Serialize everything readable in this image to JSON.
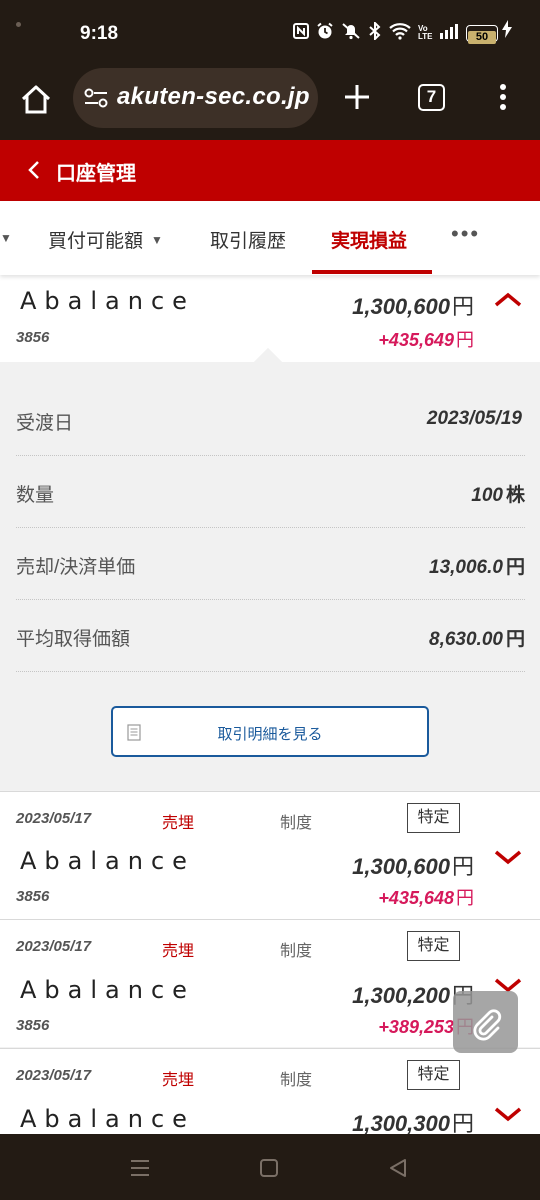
{
  "status_bar": {
    "time": "9:18",
    "battery": "50",
    "icons": [
      "nfc-icon",
      "alarm-icon",
      "mute-icon",
      "bluetooth-icon",
      "wifi-icon",
      "volte-icon",
      "signal-icon",
      "battery-icon",
      "charging-icon"
    ],
    "volte": "Vo LTE"
  },
  "browser": {
    "url": "akuten-sec.co.jp",
    "tab_count": "7"
  },
  "header": {
    "title": "口座管理"
  },
  "tabs": [
    {
      "label": "買付可能額",
      "has_caret": true
    },
    {
      "label": "取引履歴"
    },
    {
      "label": "実現損益",
      "active": true
    },
    {
      "label": "•••"
    }
  ],
  "expanded": {
    "name": "Abalance",
    "code": "3856",
    "amount": "1,300,600",
    "gain": "+435,649",
    "unit": "円",
    "details": [
      {
        "label": "受渡日",
        "value": "2023/05/19",
        "unit": ""
      },
      {
        "label": "数量",
        "value": "100",
        "unit": "株"
      },
      {
        "label": "売却/決済単価",
        "value": "13,006.0",
        "unit": "円"
      },
      {
        "label": "平均取得価額",
        "value": "8,630.00",
        "unit": "円"
      }
    ],
    "detail_button": "取引明細を見る"
  },
  "rows": [
    {
      "date": "2023/05/17",
      "trade": "売埋",
      "margin": "制度",
      "account": "特定",
      "name": "Abalance",
      "code": "3856",
      "amount": "1,300,600",
      "gain": "+435,648",
      "unit": "円"
    },
    {
      "date": "2023/05/17",
      "trade": "売埋",
      "margin": "制度",
      "account": "特定",
      "name": "Abalance",
      "code": "3856",
      "amount": "1,300,200",
      "gain": "+389,253",
      "unit": "円"
    },
    {
      "date": "2023/05/17",
      "trade": "売埋",
      "margin": "制度",
      "account": "特定",
      "name": "Abalance",
      "code": "",
      "amount": "1,300,300",
      "gain": "",
      "unit": "円"
    }
  ],
  "colors": {
    "brand_red": "#bf0000",
    "gain_pink": "#d6195b",
    "link_blue": "#1a5a9c",
    "chrome_dark": "#231b14"
  }
}
